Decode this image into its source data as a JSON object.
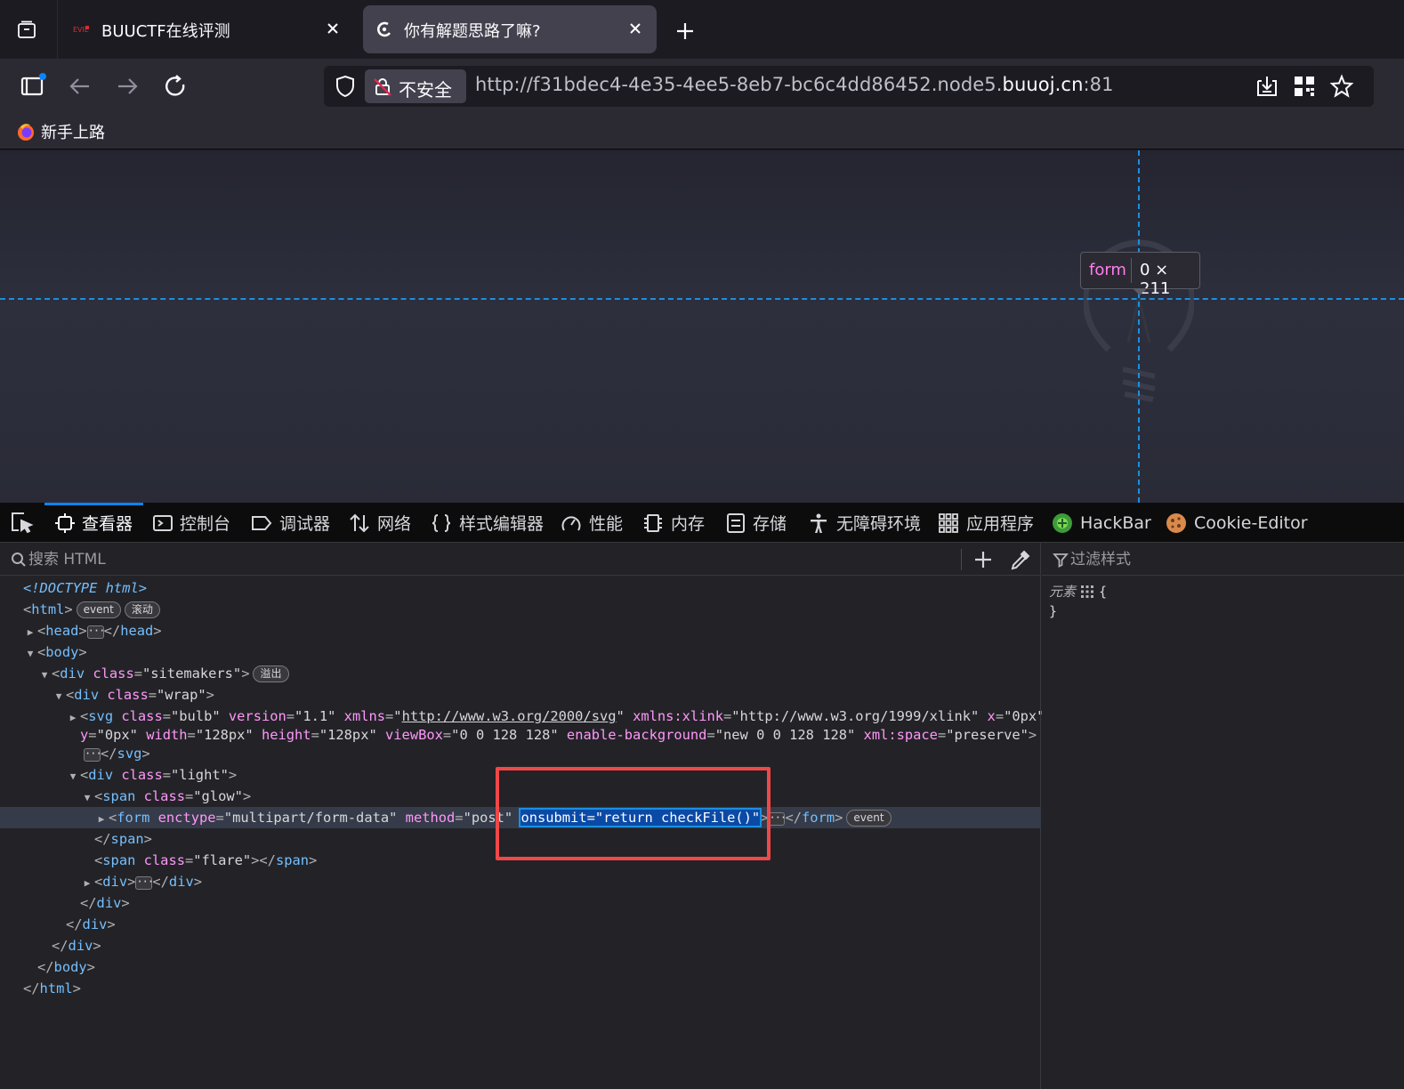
{
  "tabs": [
    {
      "title": "BUUCTF在线评测",
      "active": false
    },
    {
      "title": "你有解题思路了嘛?",
      "active": true
    }
  ],
  "urlbar": {
    "insecure_label": "不安全",
    "url_prefix": "http://f31bdec4-4e35-4ee5-8eb7-bc6c4dd86452.node5.",
    "url_domain": "buuoj.cn",
    "url_suffix": ":81"
  },
  "bookmarks": [
    {
      "label": "新手上路"
    }
  ],
  "page": {
    "infobar": {
      "tag": "form",
      "size": "0 × 211"
    }
  },
  "devtools": {
    "tabs": [
      {
        "label": "查看器",
        "active": true
      },
      {
        "label": "控制台"
      },
      {
        "label": "调试器"
      },
      {
        "label": "网络"
      },
      {
        "label": "样式编辑器"
      },
      {
        "label": "性能"
      },
      {
        "label": "内存"
      },
      {
        "label": "存储"
      },
      {
        "label": "无障碍环境"
      },
      {
        "label": "应用程序"
      },
      {
        "label": "HackBar"
      },
      {
        "label": "Cookie-Editor"
      }
    ],
    "search_placeholder": "搜索 HTML",
    "filter_placeholder": "过滤样式",
    "badges": {
      "event": "event",
      "scroll": "滚动",
      "overflow": "溢出"
    },
    "rules": {
      "element": "元素",
      "open": "{",
      "close": "}"
    },
    "tree": {
      "doctype": "<!DOCTYPE html>",
      "html_tag": "html",
      "head_tag": "head",
      "body_tag": "body",
      "div_tag": "div",
      "span_tag": "span",
      "svg_tag": "svg",
      "form_tag": "form",
      "class_attr": "class",
      "sitemakers": "\"sitemakers\"",
      "wrap": "\"wrap\"",
      "bulb": "\"bulb\"",
      "light": "\"light\"",
      "glow": "\"glow\"",
      "flare": "\"flare\"",
      "svg_version_attr": "version",
      "svg_version": "\"1.1\"",
      "svg_xmlns_attr": "xmlns",
      "svg_xmlns": "http://www.w3.org/2000/svg",
      "svg_xlink_attr": "xmlns:xlink",
      "svg_xlink": "\"http://www.w3.org/1999/xlink\"",
      "svg_x_attr": "x",
      "svg_x": "\"0px\"",
      "svg_y_attr": "y",
      "svg_y": "\"0px\"",
      "svg_w_attr": "width",
      "svg_w": "\"128px\"",
      "svg_h_attr": "height",
      "svg_h": "\"128px\"",
      "svg_vb_attr": "viewBox",
      "svg_vb": "\"0 0 128 128\"",
      "svg_eb_attr": "enable-background",
      "svg_eb": "\"new 0 0 128 128\"",
      "svg_xs_attr": "xml:space",
      "svg_xs": "\"preserve\"",
      "form_enctype_attr": "enctype",
      "form_enctype": "\"multipart/form-data\"",
      "form_method_attr": "method",
      "form_method": "\"post\"",
      "form_onsubmit_attr": "onsubmit",
      "form_onsubmit": "\"return checkFile()\""
    }
  },
  "colors": {
    "accent": "#0a84ff",
    "guide": "#1a8fe0",
    "annotation": "#f04848"
  }
}
